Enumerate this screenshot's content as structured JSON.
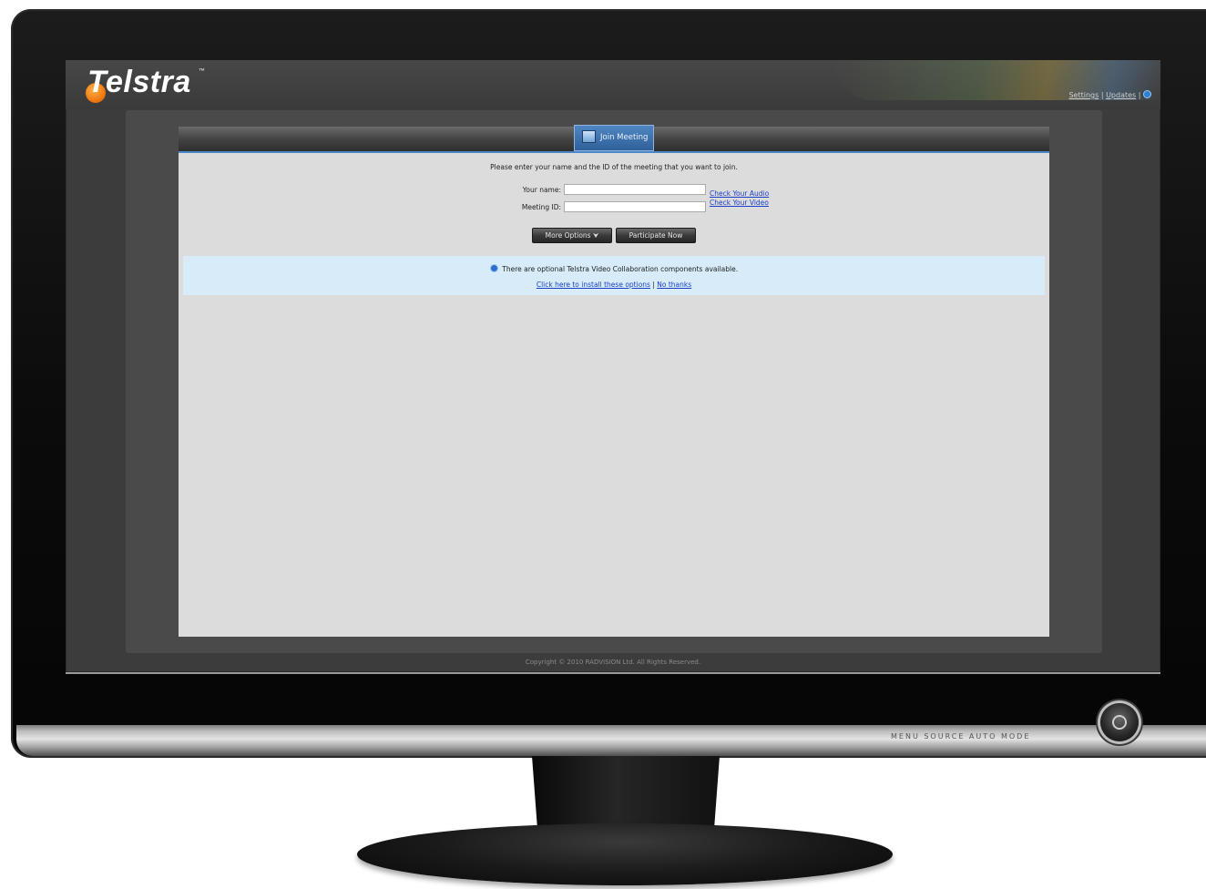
{
  "brand": {
    "logo_text": "Telstra",
    "trademark": "™"
  },
  "top_links": {
    "settings": "Settings",
    "separator": "|",
    "updates": "Updates"
  },
  "tab": {
    "label": "Join Meeting"
  },
  "form": {
    "intro": "Please enter your name and the ID of the meeting that you want to join.",
    "name_label": "Your name:",
    "name_value": "",
    "meeting_id_label": "Meeting ID:",
    "meeting_id_value": "",
    "check_audio": "Check Your Audio",
    "check_video": "Check Your Video"
  },
  "buttons": {
    "more_options": "More Options ⮟",
    "participate_now": "Participate Now"
  },
  "notice": {
    "message": "There are optional Telstra Video Collaboration components available.",
    "install_link": "Click here to install these options",
    "separator": "|",
    "dismiss_link": "No thanks"
  },
  "footer": {
    "copyright": "Copyright © 2010 RADVISION Ltd. All Rights Reserved."
  },
  "monitor": {
    "button_labels": "MENU  SOURCE  AUTO  MODE"
  },
  "colors": {
    "accent_blue": "#4b86c6",
    "brand_orange": "#f07a10",
    "link_blue": "#1a3ec8",
    "notice_bg": "#d7ecf8"
  },
  "icons": {
    "help": "help-icon",
    "info": "info-icon",
    "tab": "meeting-icon",
    "power": "power-icon"
  }
}
